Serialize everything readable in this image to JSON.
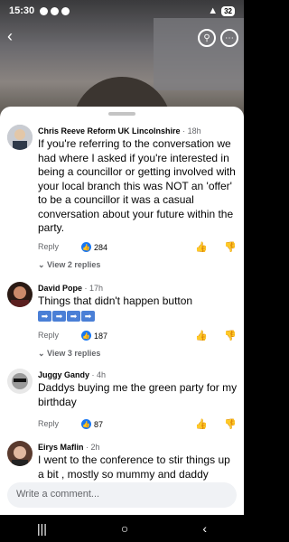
{
  "status": {
    "time": "15:30",
    "battery": "32"
  },
  "comments": [
    {
      "author": "Chris Reeve Reform UK Lincolnshire",
      "time": "18h",
      "text": "If you're referring to the conversation we had where I asked if you're interested in being a councillor or getting involved with your local branch this was NOT an 'offer' to be a councillor it was a casual conversation about your future within the party.",
      "reply_label": "Reply",
      "likes": "284",
      "view_replies": "View 2 replies"
    },
    {
      "author": "David Pope",
      "time": "17h",
      "text": "Things that didn't happen button",
      "reply_label": "Reply",
      "likes": "187",
      "view_replies": "View 3 replies"
    },
    {
      "author": "Juggy Gandy",
      "time": "4h",
      "text": "Daddys buying me the green party for my birthday",
      "reply_label": "Reply",
      "likes": "87"
    },
    {
      "author": "Eirys Maflin",
      "time": "2h",
      "text": "I went to the conference to stir things up a bit , mostly so mummy and daddy"
    }
  ],
  "composer": {
    "placeholder": "Write a comment..."
  },
  "icons": {
    "back": "chevron-left-icon",
    "search": "search-icon",
    "more": "more-icon",
    "like": "thumbs-up-icon",
    "dislike": "thumbs-down-icon"
  },
  "colors": {
    "accent": "#1877f2"
  }
}
